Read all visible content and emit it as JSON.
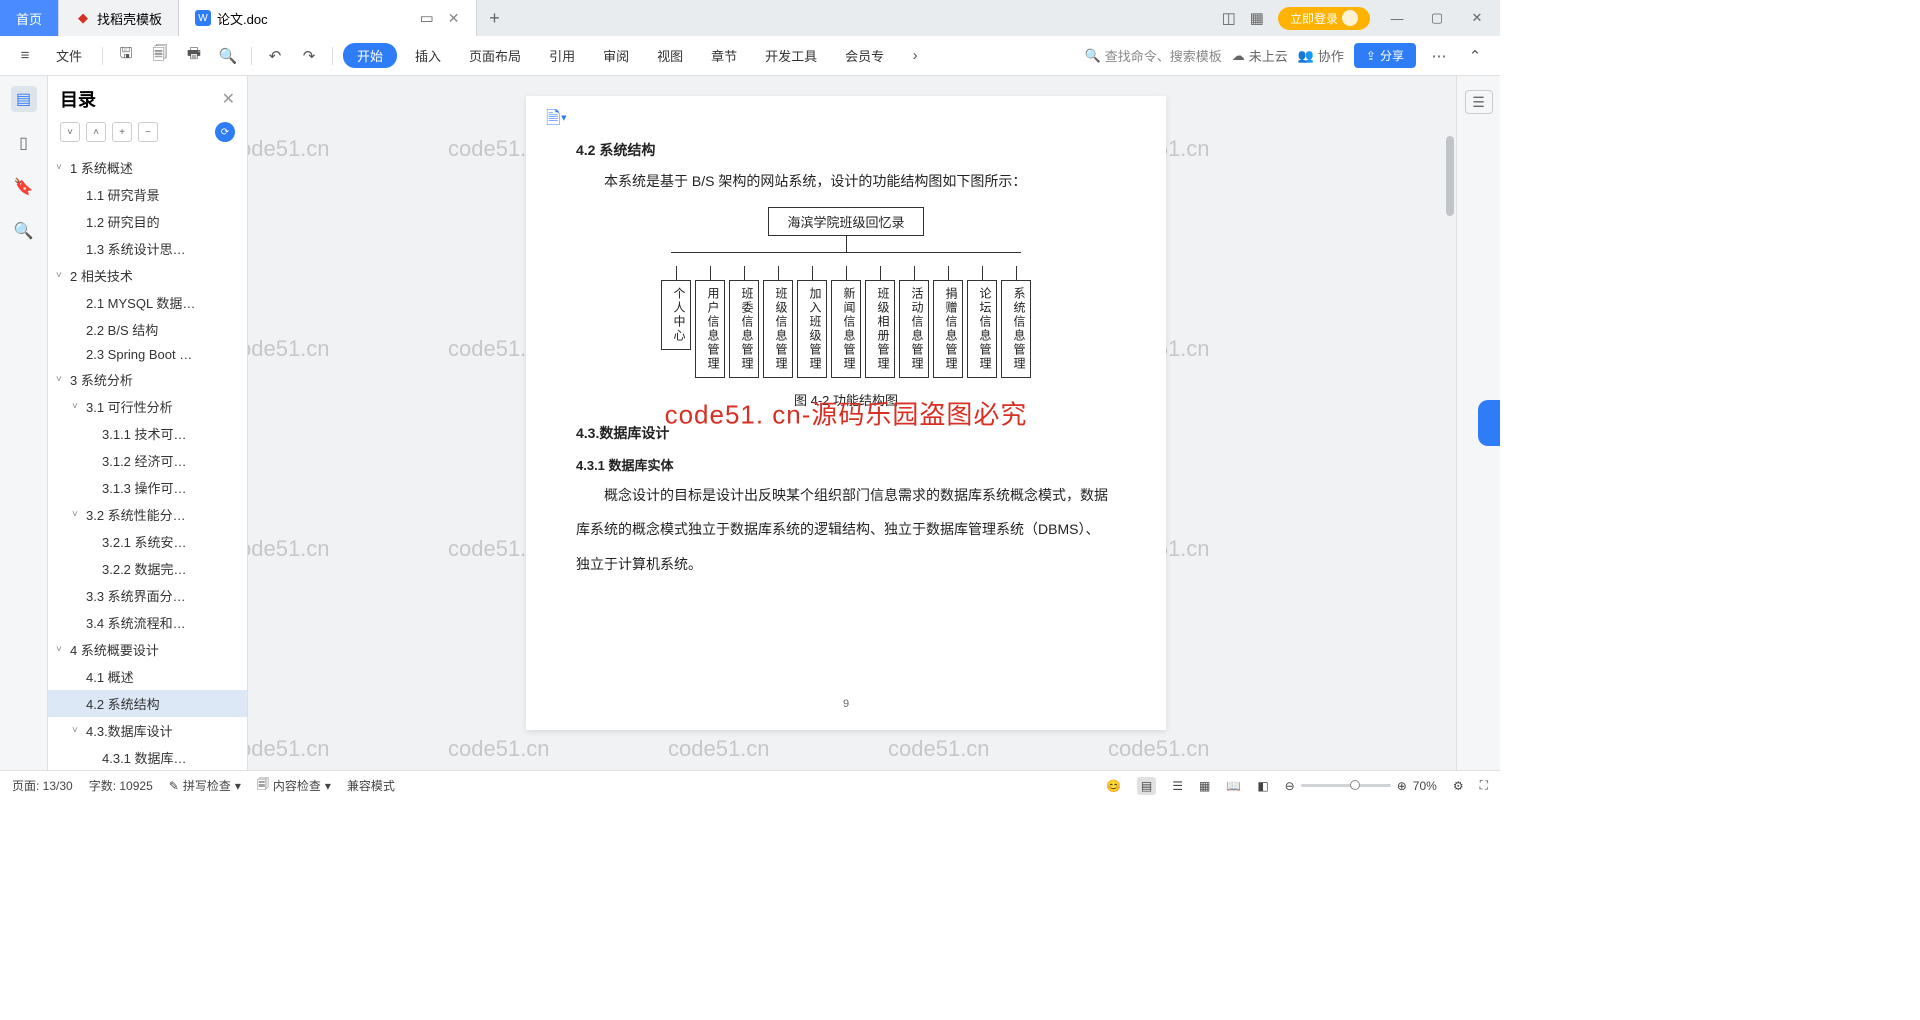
{
  "tabs": {
    "home": "首页",
    "docs": "找稻壳模板",
    "active": "论文.doc"
  },
  "login_btn": "立即登录",
  "toolbar": {
    "file": "文件",
    "menus": [
      "开始",
      "插入",
      "页面布局",
      "引用",
      "审阅",
      "视图",
      "章节",
      "开发工具",
      "会员专"
    ],
    "search_ph": "查找命令、搜索模板",
    "cloud": "未上云",
    "collab": "协作",
    "share": "分享"
  },
  "outline": {
    "title": "目录",
    "tree": [
      {
        "lvl": 1,
        "caret": "˅",
        "txt": "1 系统概述"
      },
      {
        "lvl": 2,
        "caret": "",
        "txt": "1.1 研究背景"
      },
      {
        "lvl": 2,
        "caret": "",
        "txt": "1.2 研究目的"
      },
      {
        "lvl": 2,
        "caret": "",
        "txt": "1.3 系统设计思…"
      },
      {
        "lvl": 1,
        "caret": "˅",
        "txt": "2 相关技术"
      },
      {
        "lvl": 2,
        "caret": "",
        "txt": "2.1 MYSQL 数据…"
      },
      {
        "lvl": 2,
        "caret": "",
        "txt": "2.2 B/S 结构"
      },
      {
        "lvl": 2,
        "caret": "",
        "txt": "2.3 Spring Boot …"
      },
      {
        "lvl": 1,
        "caret": "˅",
        "txt": "3 系统分析"
      },
      {
        "lvl": 2,
        "caret": "˅",
        "txt": "3.1 可行性分析"
      },
      {
        "lvl": 3,
        "caret": "",
        "txt": "3.1.1 技术可…"
      },
      {
        "lvl": 3,
        "caret": "",
        "txt": "3.1.2 经济可…"
      },
      {
        "lvl": 3,
        "caret": "",
        "txt": "3.1.3 操作可…"
      },
      {
        "lvl": 2,
        "caret": "˅",
        "txt": "3.2 系统性能分…"
      },
      {
        "lvl": 3,
        "caret": "",
        "txt": "3.2.1 系统安…"
      },
      {
        "lvl": 3,
        "caret": "",
        "txt": "3.2.2 数据完…"
      },
      {
        "lvl": 2,
        "caret": "",
        "txt": "3.3 系统界面分…"
      },
      {
        "lvl": 2,
        "caret": "",
        "txt": "3.4 系统流程和…"
      },
      {
        "lvl": 1,
        "caret": "˅",
        "txt": "4 系统概要设计"
      },
      {
        "lvl": 2,
        "caret": "",
        "txt": "4.1 概述"
      },
      {
        "lvl": 2,
        "caret": "",
        "txt": "4.2 系统结构",
        "sel": true
      },
      {
        "lvl": 2,
        "caret": "˅",
        "txt": "4.3.数据库设计"
      },
      {
        "lvl": 3,
        "caret": "",
        "txt": "4.3.1 数据库…"
      }
    ]
  },
  "doc": {
    "section_42": "4.2 系统结构",
    "para_1": "本系统是基于 B/S 架构的网站系统，设计的功能结构图如下图所示：",
    "org_root": "海滨学院班级回忆录",
    "org_items": [
      "个人中心",
      "用户信息管理",
      "班委信息管理",
      "班级信息管理",
      "加入班级管理",
      "新闻信息管理",
      "班级相册管理",
      "活动信息管理",
      "捐赠信息管理",
      "论坛信息管理",
      "系统信息管理"
    ],
    "caption_42": "图 4-2 功能结构图",
    "section_43": "4.3.数据库设计",
    "section_431": "4.3.1 数据库实体",
    "para_2a": "概念设计的目标是设计出反映某个组织部门信息需求的数据库系统概念模式，数据",
    "para_2b": "库系统的概念模式独立于数据库系统的逻辑结构、独立于数据库管理系统（DBMS）、",
    "para_2c": "独立于计算机系统。",
    "page_num": "9"
  },
  "watermark_center": "code51. cn-源码乐园盗图必究",
  "watermark_bg": "code51.cn",
  "status": {
    "page": "页面: 13/30",
    "words": "字数: 10925",
    "spell": "拼写检查",
    "content": "内容检查",
    "compat": "兼容模式",
    "zoom": "70%"
  }
}
